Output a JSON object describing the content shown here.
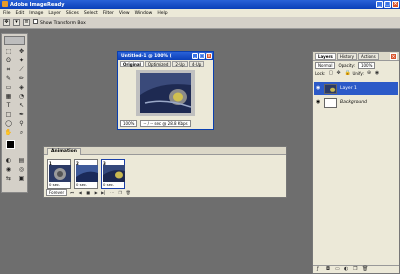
{
  "app": {
    "title": "Adobe ImageReady"
  },
  "menu": [
    "File",
    "Edit",
    "Image",
    "Layer",
    "Slices",
    "Select",
    "Filter",
    "View",
    "Window",
    "Help"
  ],
  "options": {
    "show_transform_box": "Show Transform Box"
  },
  "document": {
    "title": "Untitled-1 @ 100% (",
    "tabs": [
      "Original",
      "Optimized",
      "2-Up",
      "4-Up"
    ],
    "zoom": "100%",
    "status": "-- / -- sec @ 28.8 Kbps"
  },
  "animation": {
    "tab": "Animation",
    "frames": [
      {
        "num": "1",
        "delay": "0 sec."
      },
      {
        "num": "2",
        "delay": "0 sec."
      },
      {
        "num": "3",
        "delay": "0 sec."
      }
    ],
    "loop": "Forever"
  },
  "layers_panel": {
    "tabs": [
      "Layers",
      "History",
      "Actions"
    ],
    "blend_mode": "Normal",
    "opacity_label": "Opacity:",
    "opacity": "100%",
    "lock_label": "Lock:",
    "unify_label": "Unify:",
    "layers": [
      {
        "name": "Layer 1",
        "selected": true
      },
      {
        "name": "Background",
        "selected": false
      }
    ]
  },
  "colors": {
    "accent": "#0b3fb8",
    "workspace": "#6e6e6e"
  }
}
